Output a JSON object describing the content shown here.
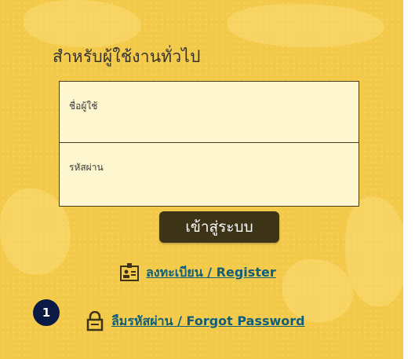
{
  "section": {
    "title": "สำหรับผู้ใช้งานทั่วไป"
  },
  "form": {
    "username_label": "ชื่อผู้ใช้",
    "password_label": "รหัสผ่าน"
  },
  "login_button": "เข้าสู่ระบบ",
  "links": {
    "register": "ลงทะเบียน / Register",
    "register_icon": "id-card-icon",
    "forgot": "ลืมรหัสผ่าน / Forgot Password",
    "forgot_icon": "lock-icon"
  },
  "badge": {
    "label": "1"
  },
  "colors": {
    "background": "#f3c94a",
    "form_fill": "#fdf6cf",
    "button": "#3d3418",
    "link": "#0f5f7a",
    "badge": "#0b1a44"
  }
}
